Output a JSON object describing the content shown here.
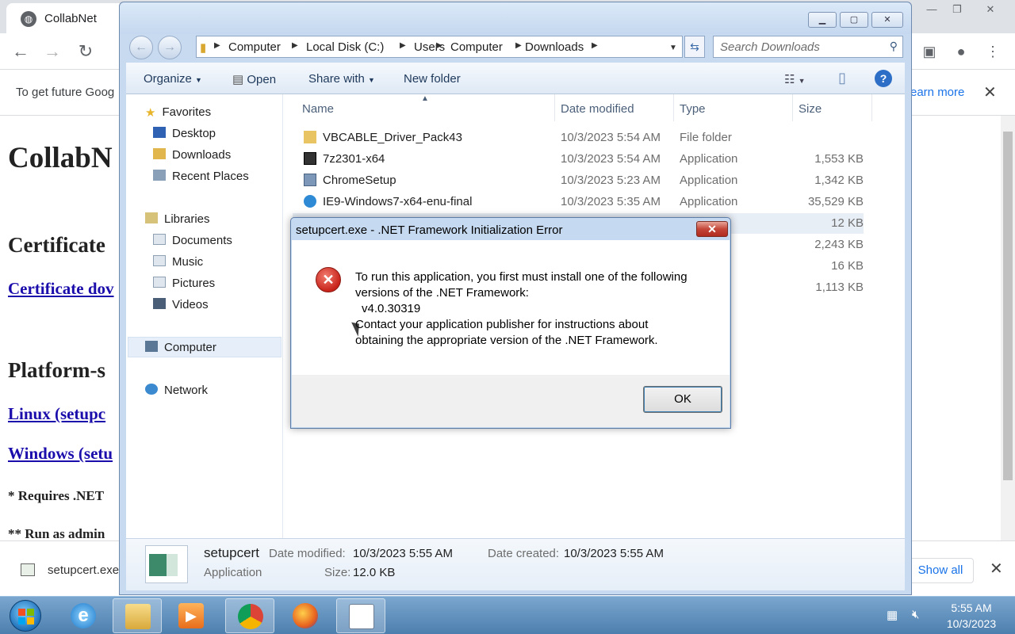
{
  "chrome": {
    "tab_title": "CollabNet",
    "infobar_text": "To get future Goog",
    "learn_more": "earn more",
    "page": {
      "h1": "CollabN",
      "h2_certificate": "Certificate",
      "link_certificate": "Certificate dov",
      "h2_platform": "Platform-s",
      "link_linux": "Linux (setupc",
      "link_windows": "Windows (setu",
      "note_requires": "* Requires .NET",
      "note_admin": "** Run as admin"
    },
    "download_filename": "setupcert.exe",
    "show_all": "Show all"
  },
  "explorer": {
    "breadcrumbs": [
      "Computer",
      "Local Disk (C:)",
      "Users",
      "Computer",
      "Downloads"
    ],
    "search_placeholder": "Search Downloads",
    "commands": {
      "organize": "Organize",
      "open": "Open",
      "share_with": "Share with",
      "new_folder": "New folder"
    },
    "nav_pane": {
      "favorites": "Favorites",
      "desktop": "Desktop",
      "downloads": "Downloads",
      "recent_places": "Recent Places",
      "libraries": "Libraries",
      "documents": "Documents",
      "music": "Music",
      "pictures": "Pictures",
      "videos": "Videos",
      "computer": "Computer",
      "network": "Network"
    },
    "columns": {
      "name": "Name",
      "date_modified": "Date modified",
      "type": "Type",
      "size": "Size"
    },
    "files": [
      {
        "name": "VBCABLE_Driver_Pack43",
        "date": "10/3/2023 5:54 AM",
        "type": "File folder",
        "size": ""
      },
      {
        "name": "7z2301-x64",
        "date": "10/3/2023 5:54 AM",
        "type": "Application",
        "size": "1,553 KB"
      },
      {
        "name": "ChromeSetup",
        "date": "10/3/2023 5:23 AM",
        "type": "Application",
        "size": "1,342 KB"
      },
      {
        "name": "IE9-Windows7-x64-enu-final",
        "date": "10/3/2023 5:35 AM",
        "type": "Application",
        "size": "35,529 KB"
      },
      {
        "name": "",
        "date": "",
        "type": "on",
        "size": "12 KB"
      },
      {
        "name": "",
        "date": "",
        "type": "on",
        "size": "2,243 KB"
      },
      {
        "name": "",
        "date": "",
        "type": "on",
        "size": "16 KB"
      },
      {
        "name": "",
        "date": "",
        "type": "ed (zipp...",
        "size": "1,113 KB"
      }
    ],
    "details": {
      "name": "setupcert",
      "type": "Application",
      "date_modified_label": "Date modified:",
      "date_modified": "10/3/2023 5:55 AM",
      "date_created_label": "Date created:",
      "date_created": "10/3/2023 5:55 AM",
      "size_label": "Size:",
      "size": "12.0 KB"
    }
  },
  "dialog": {
    "title": "setupcert.exe - .NET Framework Initialization Error",
    "line1": "To run this application, you first must install one of the following",
    "line2": "versions of the .NET Framework:",
    "line3": "v4.0.30319",
    "line4": "Contact your application publisher for instructions about",
    "line5": "obtaining the appropriate version of the .NET Framework.",
    "ok": "OK"
  },
  "taskbar": {
    "time": "5:55 AM",
    "date": "10/3/2023"
  }
}
